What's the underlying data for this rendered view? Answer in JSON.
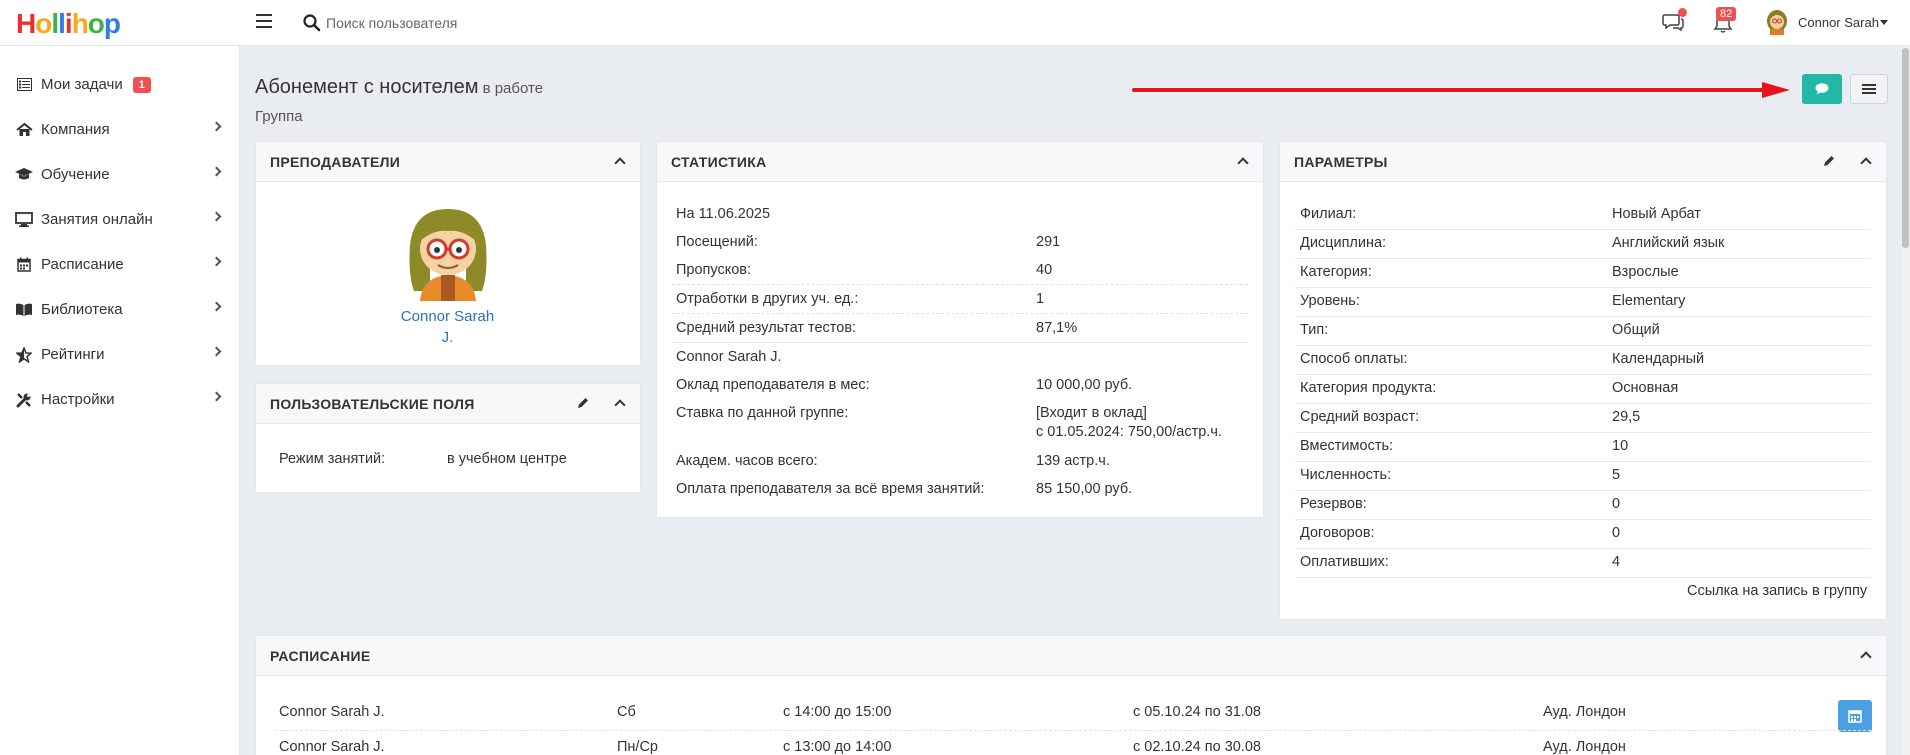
{
  "header": {
    "logo_letters": [
      "H",
      "o",
      "l",
      "l",
      "i",
      "h",
      "o",
      "p"
    ],
    "logo_colors": [
      "#e8312f",
      "#f7a81b",
      "#3bb54a",
      "#2f7de1",
      "#e8312f",
      "#f7a81b",
      "#3bb54a",
      "#2f7de1"
    ],
    "search_placeholder": "Поиск пользователя",
    "notifications_count": "82",
    "user_name": "Connor Sarah"
  },
  "sidebar": {
    "items": [
      {
        "label": "Мои задачи",
        "badge": "1"
      },
      {
        "label": "Компания"
      },
      {
        "label": "Обучение"
      },
      {
        "label": "Занятия онлайн"
      },
      {
        "label": "Расписание"
      },
      {
        "label": "Библиотека"
      },
      {
        "label": "Рейтинги"
      },
      {
        "label": "Настройки"
      }
    ]
  },
  "page": {
    "title": "Абонемент с носителем",
    "status": "в работе",
    "subtitle": "Группа"
  },
  "teachers": {
    "title": "ПРЕПОДАВАТЕЛИ",
    "name_line1": "Connor Sarah",
    "name_line2": "J."
  },
  "custom_fields": {
    "title": "ПОЛЬЗОВАТЕЛЬСКИЕ ПОЛЯ",
    "label": "Режим занятий:",
    "value": "в учебном центре"
  },
  "stats": {
    "title": "СТАТИСТИКА",
    "date": "На 11.06.2025",
    "rows": [
      {
        "label": "Посещений:",
        "value": "291"
      },
      {
        "label": "Пропусков:",
        "value": "40"
      },
      {
        "label": "Отработки в других уч. ед.:",
        "value": "1"
      },
      {
        "label": "Средний результат тестов:",
        "value": "87,1%"
      }
    ],
    "teacher_link": "Connor Sarah J.",
    "teacher_rows": [
      {
        "label": "Оклад преподавателя в мес:",
        "value": "10 000,00 руб."
      },
      {
        "label": "Ставка по данной группе:",
        "value": "[Входит в оклад]",
        "value2": "с 01.05.2024: 750,00/астр.ч."
      },
      {
        "label": "Академ. часов всего:",
        "value": "139 астр.ч."
      },
      {
        "label": "Оплата преподавателя за всё время занятий:",
        "value": "85 150,00 руб."
      }
    ]
  },
  "params": {
    "title": "ПАРАМЕТРЫ",
    "rows": [
      {
        "label": "Филиал:",
        "value": "Новый Арбат"
      },
      {
        "label": "Дисциплина:",
        "value": "Английский язык"
      },
      {
        "label": "Категория:",
        "value": "Взрослые"
      },
      {
        "label": "Уровень:",
        "value": "Elementary"
      },
      {
        "label": "Тип:",
        "value": "Общий"
      },
      {
        "label": "Способ оплаты:",
        "value": "Календарный"
      },
      {
        "label": "Категория продукта:",
        "value": "Основная"
      },
      {
        "label": "Средний возраст:",
        "value": "29,5"
      },
      {
        "label": "Вместимость:",
        "value": "10"
      },
      {
        "label": "Численность:",
        "value": "5"
      },
      {
        "label": "Резервов:",
        "value": "0"
      },
      {
        "label": "Договоров:",
        "value": "0"
      },
      {
        "label": "Оплативших:",
        "value": "4"
      }
    ],
    "signup_link": "Ссылка на запись в группу"
  },
  "schedule": {
    "title": "РАСПИСАНИЕ",
    "rows": [
      {
        "teacher": "Connor Sarah J.",
        "days": "Сб",
        "time": "с 14:00 до 15:00",
        "period": "с 05.10.24 по 31.08",
        "room": "Ауд. Лондон"
      },
      {
        "teacher": "Connor Sarah J.",
        "days": "Пн/Ср",
        "time": "с 13:00 до 14:00",
        "period": "с 02.10.24 по 30.08",
        "room": "Ауд. Лондон"
      }
    ]
  },
  "colors": {
    "accent_teal": "#23b7a5",
    "link_blue": "#2a73b9",
    "badge_red": "#f05050",
    "arrow_red": "#e8141b"
  }
}
